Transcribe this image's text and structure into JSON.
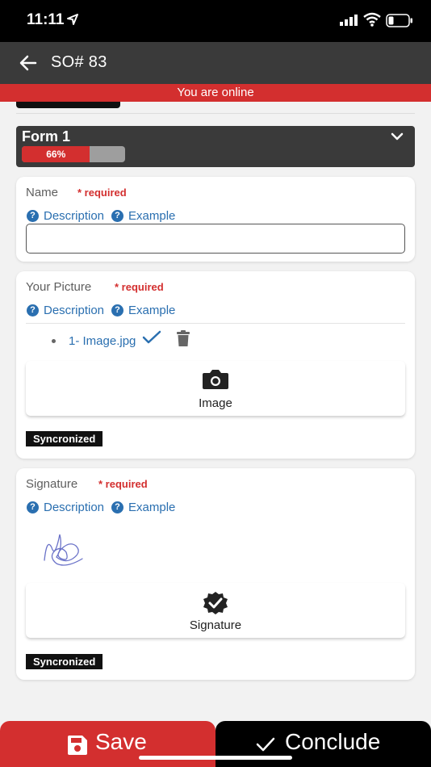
{
  "status_bar": {
    "time": "11:11"
  },
  "header": {
    "title": "SO# 83"
  },
  "online_banner": "You are online",
  "form": {
    "title": "Form 1",
    "progress_label": "66%",
    "progress_fraction": 0.66
  },
  "fields": [
    {
      "label": "Name",
      "required": "* required",
      "description": "Description",
      "example": "Example",
      "value": ""
    },
    {
      "label": "Your Picture",
      "required": "* required",
      "description": "Description",
      "example": "Example",
      "files": [
        "1- Image.jpg"
      ],
      "button_label": "Image",
      "sync_badge": "Syncronized"
    },
    {
      "label": "Signature",
      "required": "* required",
      "description": "Description",
      "example": "Example",
      "button_label": "Signature",
      "sync_badge": "Syncronized"
    }
  ],
  "footer": {
    "save_label": "Save",
    "conclude_label": "Conclude"
  },
  "colors": {
    "accent": "#d32f2f",
    "dark": "#3a3a3a",
    "link": "#2a6fb0"
  },
  "icons": [
    "location-arrow-icon",
    "signal-icon",
    "wifi-icon",
    "battery-icon",
    "back-arrow-icon",
    "chevron-down-icon",
    "help-icon",
    "check-icon",
    "trash-icon",
    "camera-icon",
    "verified-badge-icon",
    "save-icon"
  ]
}
